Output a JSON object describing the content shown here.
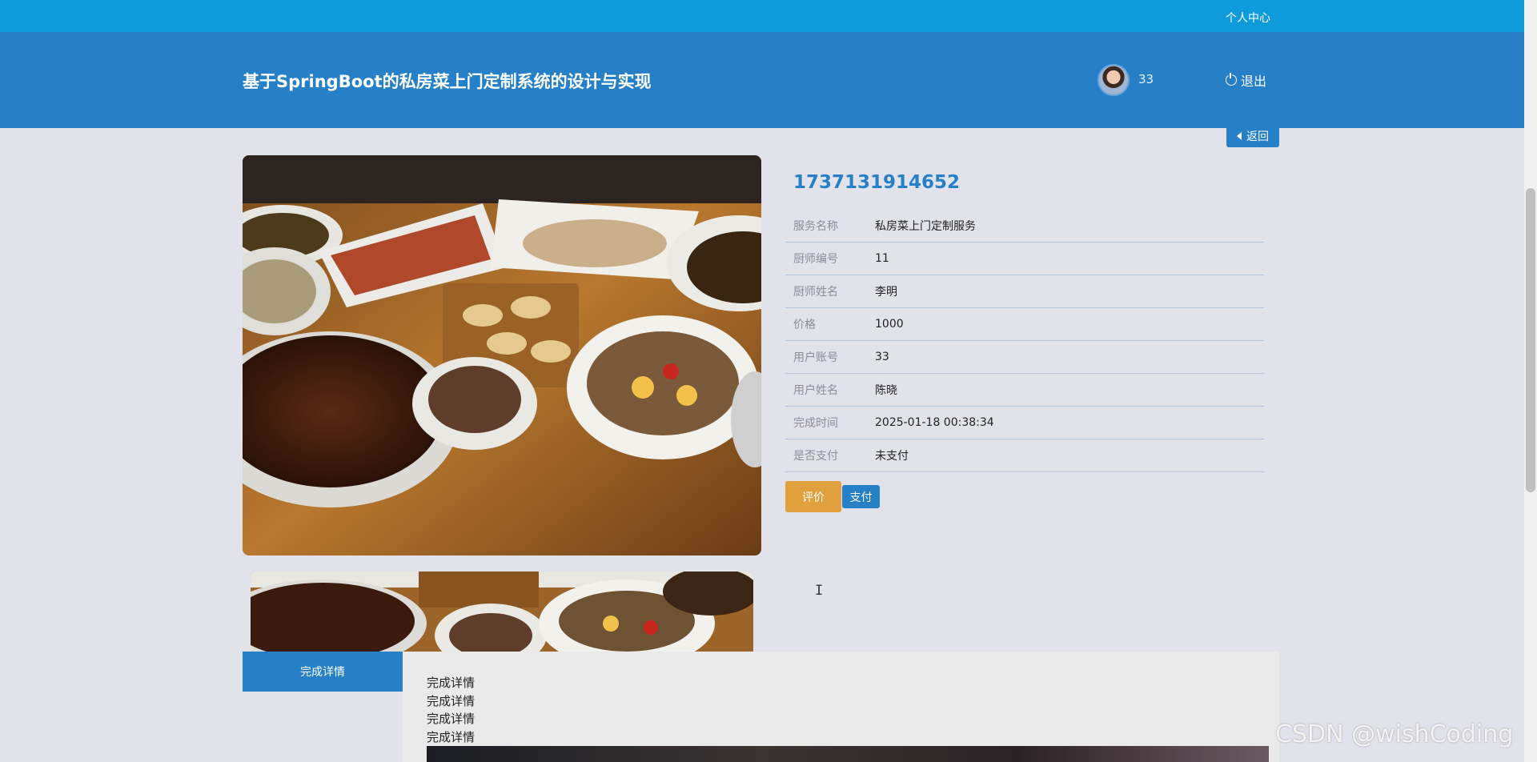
{
  "topbar": {
    "center_link": "个人中心"
  },
  "header": {
    "title": "基于SpringBoot的私房菜上门定制系统的设计与实现",
    "username": "33",
    "logout_label": "退出"
  },
  "back_label": "返回",
  "order": {
    "number": "1737131914652",
    "fields": [
      {
        "key": "服务名称",
        "value": "私房菜上门定制服务"
      },
      {
        "key": "厨师编号",
        "value": "11"
      },
      {
        "key": "厨师姓名",
        "value": "李明"
      },
      {
        "key": "价格",
        "value": "1000"
      },
      {
        "key": "用户账号",
        "value": "33"
      },
      {
        "key": "用户姓名",
        "value": "陈晓"
      },
      {
        "key": "完成时间",
        "value": "2025-01-18 00:38:34"
      },
      {
        "key": "是否支付",
        "value": "未支付"
      }
    ]
  },
  "actions": {
    "review_label": "评价",
    "pay_label": "支付"
  },
  "tabs": {
    "active_label": "完成详情",
    "content_lines": [
      "完成详情",
      "完成详情",
      "完成详情",
      "完成详情"
    ]
  },
  "watermark": "CSDN @wishCoding",
  "colors": {
    "primary": "#2580c7",
    "topbar": "#0f9adb",
    "review": "#e0a03e"
  }
}
